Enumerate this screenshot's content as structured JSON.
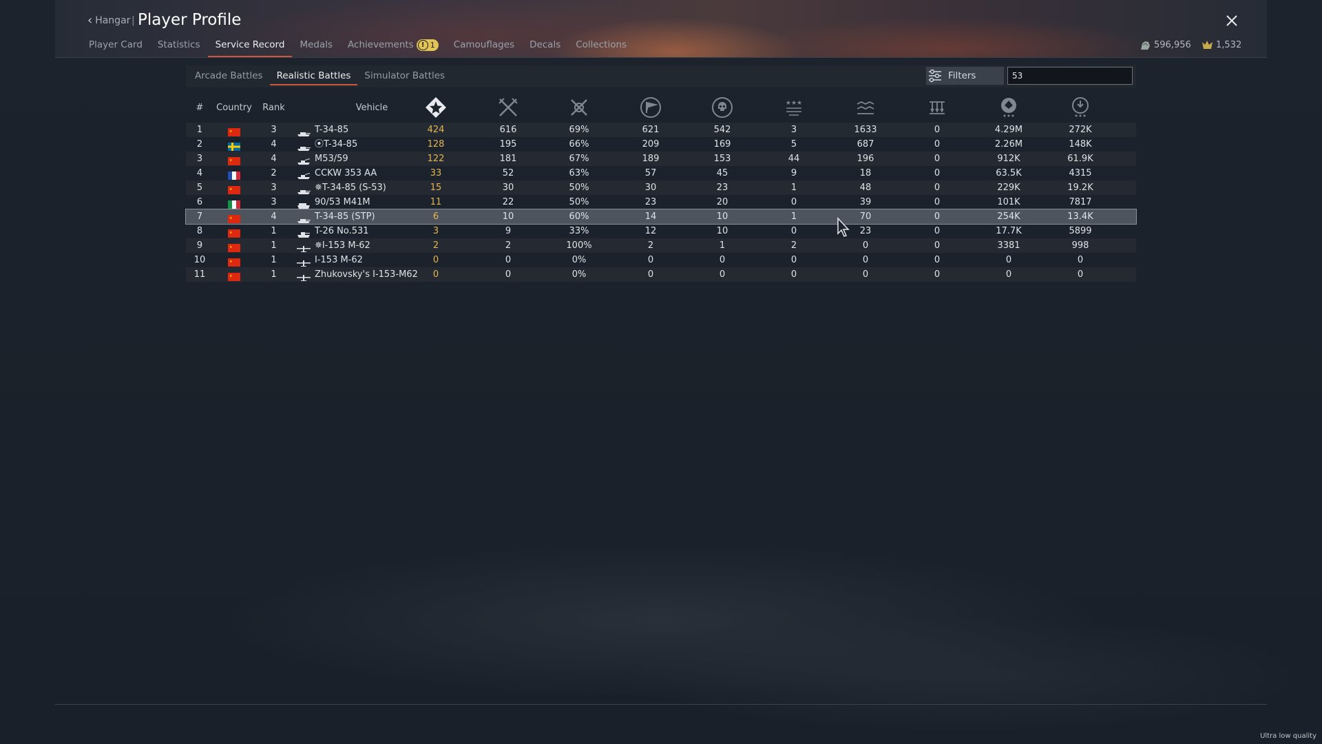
{
  "header": {
    "back_label": "Hangar",
    "separator": "|",
    "title": "Player Profile",
    "close_icon": "close-icon"
  },
  "main_tabs": [
    {
      "label": "Player Card",
      "active": false
    },
    {
      "label": "Statistics",
      "active": false
    },
    {
      "label": "Service Record",
      "active": true
    },
    {
      "label": "Medals",
      "active": false
    },
    {
      "label": "Achievements",
      "active": false,
      "badge": "1"
    },
    {
      "label": "Camouflages",
      "active": false
    },
    {
      "label": "Decals",
      "active": false
    },
    {
      "label": "Collections",
      "active": false
    }
  ],
  "currency": {
    "silver": "596,956",
    "gold": "1,532",
    "silver_icon": "silver-lions-icon",
    "gold_icon": "golden-eagles-icon"
  },
  "sub_tabs": [
    {
      "label": "Arcade Battles",
      "active": false
    },
    {
      "label": "Realistic Battles",
      "active": true
    },
    {
      "label": "Simulator Battles",
      "active": false
    }
  ],
  "filters": {
    "label": "Filters",
    "search_value": "53"
  },
  "columns": {
    "num": "#",
    "country": "Country",
    "rank": "Rank",
    "vehicle": "Vehicle",
    "icons": [
      "battles-icon",
      "respawns-icon",
      "victories-icon",
      "missions-icon",
      "deaths-icon",
      "air-kills-icon",
      "ground-kills-icon",
      "naval-kills-icon",
      "experience-icon",
      "score-icon"
    ]
  },
  "colors": {
    "accent": "#d0563b",
    "gold_value": "#e3b653",
    "badge": "#e0c455"
  },
  "rows": [
    {
      "num": "1",
      "country": "china",
      "rank": "3",
      "type": "tank",
      "vehicle": "T-34-85",
      "battles": "424",
      "c2": "616",
      "c3": "69%",
      "c4": "621",
      "c5": "542",
      "c6": "3",
      "c7": "1633",
      "c8": "0",
      "c9": "4.29M",
      "c10": "272K"
    },
    {
      "num": "2",
      "country": "sweden",
      "rank": "4",
      "type": "tank",
      "vehicle": "⦿T-34-85",
      "battles": "128",
      "c2": "195",
      "c3": "66%",
      "c4": "209",
      "c5": "169",
      "c6": "5",
      "c7": "687",
      "c8": "0",
      "c9": "2.26M",
      "c10": "148K"
    },
    {
      "num": "3",
      "country": "china",
      "rank": "4",
      "type": "spaa",
      "vehicle": "M53/59",
      "battles": "122",
      "c2": "181",
      "c3": "67%",
      "c4": "189",
      "c5": "153",
      "c6": "44",
      "c7": "196",
      "c8": "0",
      "c9": "912K",
      "c10": "61.9K"
    },
    {
      "num": "4",
      "country": "france",
      "rank": "2",
      "type": "spaa",
      "vehicle": "CCKW 353 AA",
      "battles": "33",
      "c2": "52",
      "c3": "63%",
      "c4": "57",
      "c5": "45",
      "c6": "9",
      "c7": "18",
      "c8": "0",
      "c9": "63.5K",
      "c10": "4315"
    },
    {
      "num": "5",
      "country": "china",
      "rank": "3",
      "type": "tank",
      "vehicle": "✵T-34-85 (S-53)",
      "battles": "15",
      "c2": "30",
      "c3": "50%",
      "c4": "30",
      "c5": "23",
      "c6": "1",
      "c7": "48",
      "c8": "0",
      "c9": "229K",
      "c10": "19.2K"
    },
    {
      "num": "6",
      "country": "italy",
      "rank": "3",
      "type": "td",
      "vehicle": "90/53 M41M",
      "battles": "11",
      "c2": "22",
      "c3": "50%",
      "c4": "23",
      "c5": "20",
      "c6": "0",
      "c7": "39",
      "c8": "0",
      "c9": "101K",
      "c10": "7817"
    },
    {
      "num": "7",
      "country": "china",
      "rank": "4",
      "type": "tank",
      "vehicle": "T-34-85 (STP)",
      "battles": "6",
      "c2": "10",
      "c3": "60%",
      "c4": "14",
      "c5": "10",
      "c6": "1",
      "c7": "70",
      "c8": "0",
      "c9": "254K",
      "c10": "13.4K",
      "selected": true
    },
    {
      "num": "8",
      "country": "china",
      "rank": "1",
      "type": "light",
      "vehicle": "T-26 No.531",
      "battles": "3",
      "c2": "9",
      "c3": "33%",
      "c4": "12",
      "c5": "10",
      "c6": "0",
      "c7": "23",
      "c8": "0",
      "c9": "17.7K",
      "c10": "5899"
    },
    {
      "num": "9",
      "country": "china",
      "rank": "1",
      "type": "plane",
      "vehicle": "✵I-153 M-62",
      "battles": "2",
      "c2": "2",
      "c3": "100%",
      "c4": "2",
      "c5": "1",
      "c6": "2",
      "c7": "0",
      "c8": "0",
      "c9": "3381",
      "c10": "998"
    },
    {
      "num": "10",
      "country": "china",
      "rank": "1",
      "type": "plane",
      "vehicle": "I-153 M-62",
      "battles": "0",
      "c2": "0",
      "c3": "0%",
      "c4": "0",
      "c5": "0",
      "c6": "0",
      "c7": "0",
      "c8": "0",
      "c9": "0",
      "c10": "0"
    },
    {
      "num": "11",
      "country": "china",
      "rank": "1",
      "type": "plane",
      "vehicle": "Zhukovsky's I-153-M62",
      "battles": "0",
      "c2": "0",
      "c3": "0%",
      "c4": "0",
      "c5": "0",
      "c6": "0",
      "c7": "0",
      "c8": "0",
      "c9": "0",
      "c10": "0"
    }
  ],
  "footer": {
    "quality_label": "Ultra low quality"
  }
}
